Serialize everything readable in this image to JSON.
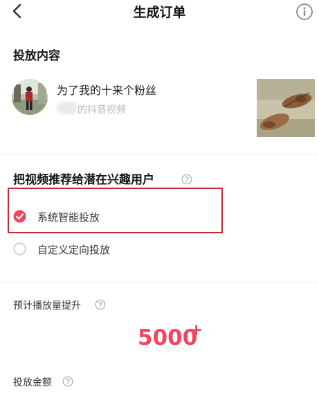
{
  "header": {
    "title": "生成订单",
    "back_icon": "chevron-left-icon",
    "info_icon": "info-icon"
  },
  "content_section": {
    "title": "投放内容",
    "video": {
      "title": "为了我的十来个粉丝",
      "author_suffix": "的抖音视频"
    }
  },
  "recommend_section": {
    "title": "把视频推荐给潜在兴趣用户",
    "options": [
      {
        "label": "系统智能投放",
        "selected": true
      },
      {
        "label": "自定义定向投放",
        "selected": false
      }
    ]
  },
  "estimate": {
    "label": "预计播放量提升",
    "value": "5000",
    "suffix": "+"
  },
  "amount": {
    "label": "投放金额"
  },
  "colors": {
    "accent": "#f0455d",
    "highlight_border": "#c8282f"
  }
}
